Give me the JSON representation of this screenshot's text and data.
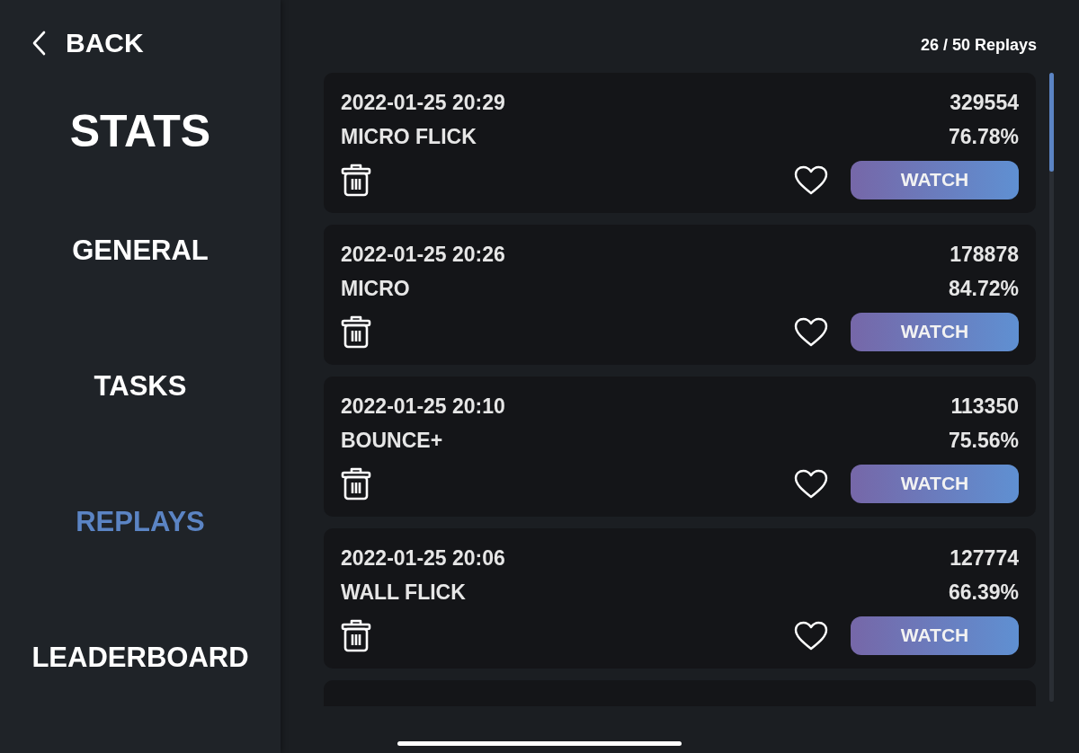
{
  "back": {
    "label": "BACK"
  },
  "title": "STATS",
  "nav": [
    {
      "label": "GENERAL",
      "selected": false
    },
    {
      "label": "TASKS",
      "selected": false
    },
    {
      "label": "REPLAYS",
      "selected": true
    },
    {
      "label": "LEADERBOARD",
      "selected": false
    }
  ],
  "replay_count": "26 / 50 Replays",
  "replays": [
    {
      "kind": "full",
      "date": "2022-01-25 20:29",
      "score": "329554",
      "mode": "MICRO FLICK",
      "accuracy": "76.78%",
      "favorite": false,
      "button": "WATCH"
    },
    {
      "kind": "full",
      "date": "2022-01-25 20:26",
      "score": "178878",
      "mode": "MICRO",
      "accuracy": "84.72%",
      "favorite": false,
      "button": "WATCH"
    },
    {
      "kind": "full",
      "date": "2022-01-25 20:10",
      "score": "113350",
      "mode": "BOUNCE+",
      "accuracy": "75.56%",
      "favorite": false,
      "button": "WATCH"
    },
    {
      "kind": "full",
      "date": "2022-01-25 20:06",
      "score": "127774",
      "mode": "WALL FLICK",
      "accuracy": "66.39%",
      "favorite": false,
      "button": "WATCH"
    },
    {
      "kind": "cut_off"
    }
  ]
}
